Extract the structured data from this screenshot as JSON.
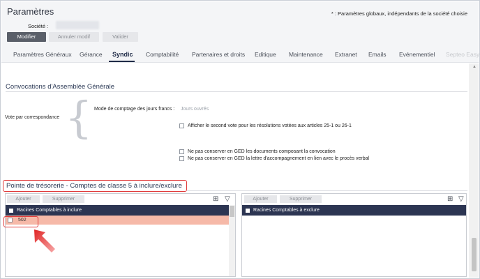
{
  "header": {
    "title": "Paramètres",
    "note": "* : Paramètres globaux, indépendants de la société choisie",
    "societe_label": "Société :",
    "buttons": {
      "modifier": "Modifier",
      "annuler": "Annuler modif",
      "valider": "Valider"
    }
  },
  "tabs": [
    "Paramètres Généraux",
    "Gérance",
    "Syndic",
    "Comptabilité",
    "Partenaires et droits",
    "Editique",
    "Maintenance",
    "Extranet",
    "Emails",
    "Evénementiel",
    "Septeo Easy"
  ],
  "active_tab": "Syndic",
  "convocations": {
    "title": "Convocations d'Assemblée Générale",
    "vote_label": "Vote par correspondance",
    "mode_label": "Mode de comptage des jours francs :",
    "mode_value": "Jours ouvrés",
    "second_vote": "Afficher le second vote pour les résolutions votées aux articles 25-1 ou 26-1",
    "ged_docs": "Ne pas conserver en GED les documents composant la convocation",
    "ged_lettre": "Ne pas conserver en GED la lettre d'accompagnement en lien avec le procès verbal"
  },
  "pointe": {
    "title": "Pointe de trésorerie - Comptes de classe 5 à inclure/exclure",
    "ajouter": "Ajouter",
    "supprimer": "Supprimer",
    "include_header": "Racines Comptables à inclure",
    "exclude_header": "Racines Comptables à exclure",
    "include_rows": [
      "502"
    ]
  },
  "colors": {
    "navy": "#2c3552",
    "highlight": "#f6b9a8",
    "annotation": "#e03a3a"
  }
}
